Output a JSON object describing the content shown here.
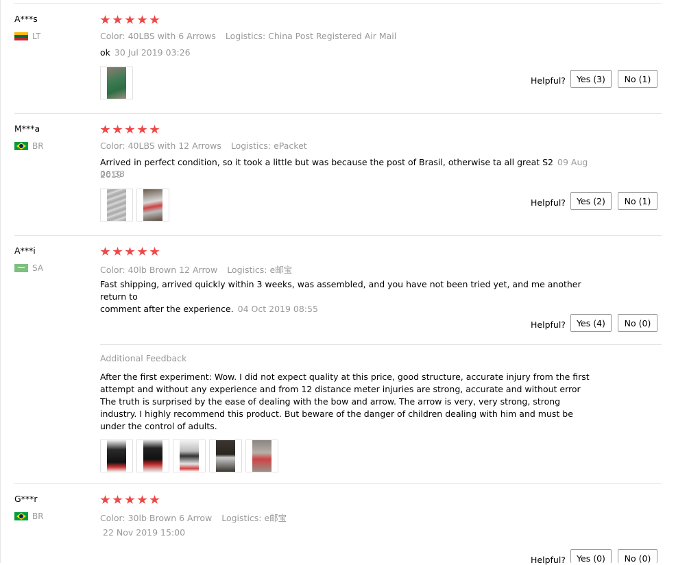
{
  "helpful_label": "Helpful?",
  "additional_feedback_label": "Additional Feedback",
  "reviews": [
    {
      "user": "A***s",
      "country": "LT",
      "color": "Color: 40LBS with 6 Arrows",
      "logistics": "Logistics: China Post Registered Air Mail",
      "text": "ok",
      "date": "30 Jul 2019 03:26",
      "yes": "Yes (3)",
      "no": "No (1)"
    },
    {
      "user": "M***a",
      "country": "BR",
      "color": "Color: 40LBS with 12 Arrows",
      "logistics": "Logistics: ePacket",
      "text": "Arrived in perfect condition, so it took a little but was because the post of Brasil, otherwise ta all great S2",
      "date_part1": "09 Aug 2019",
      "date_part2": "06:33",
      "yes": "Yes (2)",
      "no": "No (1)"
    },
    {
      "user": "A***i",
      "country": "SA",
      "color": "Color: 40lb Brown 12 Arrow",
      "logistics": "Logistics: e邮宝",
      "text_line1": "Fast shipping, arrived quickly within 3 weeks, was assembled, and you have not been tried yet, and me another return to",
      "text_line2": "comment after the experience.",
      "date": "04 Oct 2019 08:55",
      "yes": "Yes (4)",
      "no": "No (0)",
      "additional": [
        "After the first experiment: Wow. I did not expect quality at this price, good structure, accurate injury from the first",
        "attempt and without any experience and from 12 distance meter injuries are strong, accurate and without error",
        "The truth is surprised by the ease of dealing with the bow and arrow. The arrow is very, very strong, strong",
        "industry. I highly recommend this product. But beware of the danger of children dealing with him and must be",
        "under the control of adults."
      ]
    },
    {
      "user": "G***r",
      "country": "BR",
      "color": "Color: 30lb Brown 6 Arrow",
      "logistics": "Logistics: e邮宝",
      "date": "22 Nov 2019 15:00",
      "yes": "Yes (0)",
      "no": "No (0)"
    }
  ]
}
